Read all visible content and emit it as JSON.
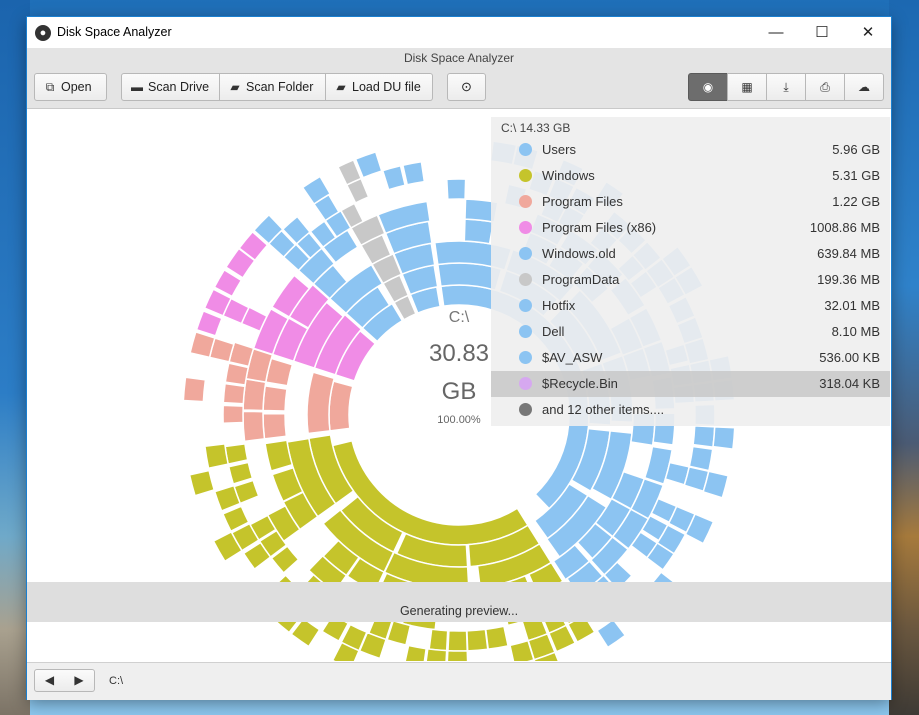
{
  "window": {
    "title": "Disk Space Analyzer",
    "subtitle": "Disk Space Analyzer",
    "minimize_glyph": "—",
    "maximize_glyph": "☐",
    "close_glyph": "✕"
  },
  "toolbar": {
    "open_label": "Open",
    "scan_drive_label": "Scan Drive",
    "scan_folder_label": "Scan Folder",
    "load_du_label": "Load DU file",
    "upload_icon": "upload-circle-icon",
    "views": [
      {
        "name": "sunburst-view",
        "glyph": "◉",
        "active": true
      },
      {
        "name": "treemap-view",
        "glyph": "▦",
        "active": false
      },
      {
        "name": "download",
        "glyph": "⤓",
        "active": false
      },
      {
        "name": "print",
        "glyph": "⎙",
        "active": false
      },
      {
        "name": "cloud",
        "glyph": "☁",
        "active": false
      }
    ]
  },
  "legend": {
    "title": "C:\\ 14.33 GB",
    "items": [
      {
        "name": "Users",
        "size": "5.96 GB",
        "color": "#8cc4f2"
      },
      {
        "name": "Windows",
        "size": "5.31 GB",
        "color": "#c5c42b"
      },
      {
        "name": "Program Files",
        "size": "1.22 GB",
        "color": "#f0a89c"
      },
      {
        "name": "Program Files (x86)",
        "size": "1008.86 MB",
        "color": "#f08ce6"
      },
      {
        "name": "Windows.old",
        "size": "639.84 MB",
        "color": "#8cc4f2"
      },
      {
        "name": "ProgramData",
        "size": "199.36 MB",
        "color": "#c8c8c8"
      },
      {
        "name": "Hotfix",
        "size": "32.01 MB",
        "color": "#8cc4f2"
      },
      {
        "name": "Dell",
        "size": "8.10 MB",
        "color": "#8cc4f2"
      },
      {
        "name": "$AV_ASW",
        "size": "536.00 KB",
        "color": "#8cc4f2"
      },
      {
        "name": "$Recycle.Bin",
        "size": "318.04 KB",
        "color": "#d6a8f0",
        "highlighted": true
      },
      {
        "name": "and 12 other items....",
        "size": "",
        "color": "#777777"
      }
    ]
  },
  "center": {
    "name": "C:\\",
    "size": "30.83",
    "unit": "GB",
    "percent": "100.00%"
  },
  "preview_text": "Generating preview...",
  "status": {
    "path": "C:\\"
  },
  "colors": {
    "users": "#8cc4f2",
    "windows": "#c5c42b",
    "program_files": "#f0a89c",
    "program_files_x86": "#f08ce6",
    "programdata": "#c8c8c8",
    "accent_active": "#6d6d6d"
  }
}
